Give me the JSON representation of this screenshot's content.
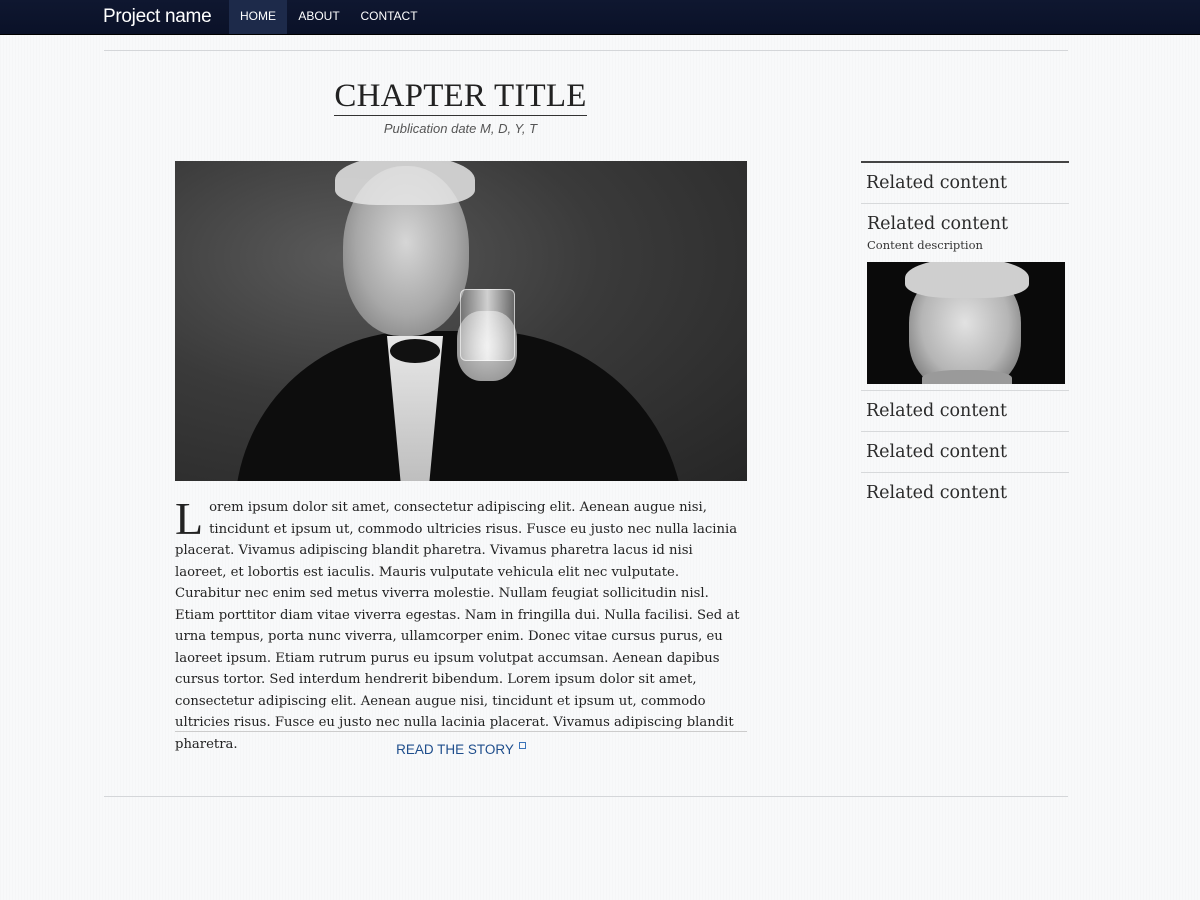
{
  "navbar": {
    "brand": "Project name",
    "items": [
      {
        "label": "HOME",
        "active": true
      },
      {
        "label": "ABOUT",
        "active": false
      },
      {
        "label": "CONTACT",
        "active": false
      }
    ],
    "bg_color": "#0f1730"
  },
  "article": {
    "title": "CHAPTER TITLE",
    "publication_date": "Publication date M, D, Y, T",
    "hero_image": "portrait-photo-man-in-tuxedo-raising-glass",
    "drop_cap": "L",
    "body": "orem ipsum dolor sit amet, consectetur adipiscing elit. Aenean augue nisi, tincidunt et ipsum ut, commodo ultricies risus. Fusce eu justo nec nulla lacinia placerat. Vivamus adipiscing blandit pharetra. Vivamus pharetra lacus id nisi laoreet, et lobortis est iaculis. Mauris vulputate vehicula elit nec vulputate. Curabitur nec enim sed metus viverra molestie. Nullam feugiat sollicitudin nisl. Etiam porttitor diam vitae viverra egestas. Nam in fringilla dui. Nulla facilisi. Sed at urna tempus, porta nunc viverra, ullamcorper enim. Donec vitae cursus purus, eu laoreet ipsum. Etiam rutrum purus eu ipsum volutpat accumsan. Aenean dapibus cursus tortor. Sed interdum hendrerit bibendum. Lorem ipsum dolor sit amet, consectetur adipiscing elit. Aenean augue nisi, tincidunt et ipsum ut, commodo ultricies risus. Fusce eu justo nec nulla lacinia placerat. Vivamus adipiscing blandit pharetra.",
    "read_story_label": "READ THE STORY",
    "link_color": "#1f4e8c"
  },
  "sidebar": {
    "items": [
      {
        "label": "Related content"
      },
      {
        "label": "Related content",
        "description": "Content description",
        "thumbnail": "portrait-photo-man-squinting"
      },
      {
        "label": "Related content"
      },
      {
        "label": "Related content"
      },
      {
        "label": "Related content"
      }
    ]
  }
}
